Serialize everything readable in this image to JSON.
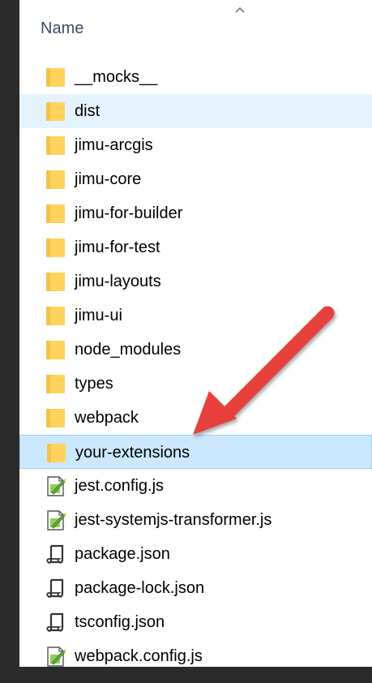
{
  "header": {
    "name_label": "Name"
  },
  "colors": {
    "folder": "#ffd35c",
    "folder_dark": "#e6b73e",
    "hover": "#e5f3ff",
    "selected": "#cce8ff",
    "selected_border": "#99d1ff",
    "arrow": "#e8403c"
  },
  "files": [
    {
      "name": "__mocks__",
      "icon": "folder-icon",
      "state": "normal"
    },
    {
      "name": "dist",
      "icon": "folder-icon",
      "state": "hover"
    },
    {
      "name": "jimu-arcgis",
      "icon": "folder-icon",
      "state": "normal"
    },
    {
      "name": "jimu-core",
      "icon": "folder-icon",
      "state": "normal"
    },
    {
      "name": "jimu-for-builder",
      "icon": "folder-icon",
      "state": "normal"
    },
    {
      "name": "jimu-for-test",
      "icon": "folder-icon",
      "state": "normal"
    },
    {
      "name": "jimu-layouts",
      "icon": "folder-icon",
      "state": "normal"
    },
    {
      "name": "jimu-ui",
      "icon": "folder-icon",
      "state": "normal"
    },
    {
      "name": "node_modules",
      "icon": "folder-icon",
      "state": "normal"
    },
    {
      "name": "types",
      "icon": "folder-icon",
      "state": "normal"
    },
    {
      "name": "webpack",
      "icon": "folder-icon",
      "state": "normal"
    },
    {
      "name": "your-extensions",
      "icon": "folder-icon",
      "state": "selected"
    },
    {
      "name": "jest.config.js",
      "icon": "js-file-icon",
      "state": "normal"
    },
    {
      "name": "jest-systemjs-transformer.js",
      "icon": "js-file-icon",
      "state": "normal"
    },
    {
      "name": "package.json",
      "icon": "json-file-icon",
      "state": "normal"
    },
    {
      "name": "package-lock.json",
      "icon": "json-file-icon",
      "state": "normal"
    },
    {
      "name": "tsconfig.json",
      "icon": "json-file-icon",
      "state": "normal"
    },
    {
      "name": "webpack.config.js",
      "icon": "js-file-icon",
      "state": "normal"
    }
  ]
}
